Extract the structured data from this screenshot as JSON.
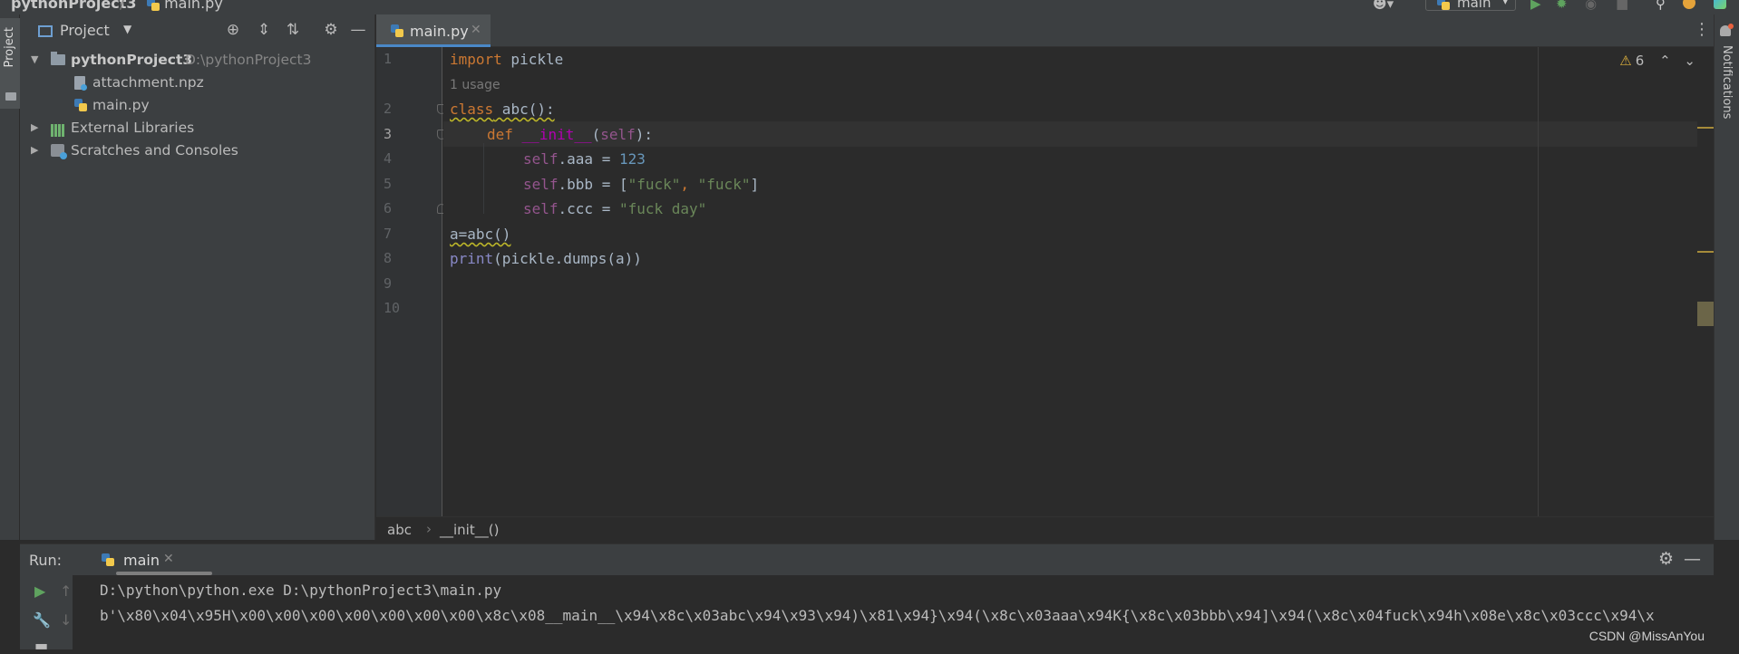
{
  "topbar": {
    "project_crumb": "pythonProject3",
    "separator": "/",
    "file_crumb": "main.py",
    "run_config": "main",
    "icons": [
      "add-user-icon",
      "run-icon",
      "debug-icon",
      "coverage-icon",
      "stop-icon",
      "search-icon",
      "update-icon",
      "jetbrains-logo-icon"
    ]
  },
  "left_strip": {
    "project_tab": "Project"
  },
  "project_panel": {
    "title": "Project",
    "header_icons": [
      "locate-icon",
      "expand-all-icon",
      "collapse-all-icon",
      "gear-icon",
      "minimize-icon"
    ],
    "tree": {
      "root_name": "pythonProject3",
      "root_path": "D:\\pythonProject3",
      "files": [
        "attachment.npz",
        "main.py"
      ],
      "external_libraries": "External Libraries",
      "scratches": "Scratches and Consoles"
    }
  },
  "editor": {
    "tab_label": "main.py",
    "line_numbers": [
      "1",
      "2",
      "3",
      "4",
      "5",
      "6",
      "7",
      "8",
      "9",
      "10"
    ],
    "usage_hint": "1 usage",
    "warnings_count": "6",
    "code": {
      "l1_kw": "import",
      "l1_rest": " pickle",
      "l2_kw": "class",
      "l2_rest": " abc():",
      "l3_kw": "def",
      "l3_fn": "__init__",
      "l3_open": "(",
      "l3_self": "self",
      "l3_close": "):",
      "l4_self": "self",
      "l4_attr": ".aaa = ",
      "l4_num": "123",
      "l5_self": "self",
      "l5_attr": ".bbb = [",
      "l5_s1": "\"fuck\"",
      "l5_comma": ", ",
      "l5_s2": "\"fuck\"",
      "l5_close": "]",
      "l6_self": "self",
      "l6_attr": ".ccc = ",
      "l6_str": "\"fuck day\"",
      "l7": "a=abc()",
      "l8_fn": "print",
      "l8_rest": "(pickle.dumps(a))"
    },
    "breadcrumb": {
      "class": "abc",
      "separator": "›",
      "method": "__init__()"
    }
  },
  "right_strip": {
    "notifications": "Notifications"
  },
  "run_panel": {
    "label": "Run:",
    "tab": "main",
    "console": [
      "D:\\python\\python.exe D:\\pythonProject3\\main.py",
      "b'\\x80\\x04\\x95H\\x00\\x00\\x00\\x00\\x00\\x00\\x00\\x8c\\x08__main__\\x94\\x8c\\x03abc\\x94\\x93\\x94)\\x81\\x94}\\x94(\\x8c\\x03aaa\\x94K{\\x8c\\x03bbb\\x94]\\x94(\\x8c\\x04fuck\\x94h\\x08e\\x8c\\x03ccc\\x94\\x"
    ]
  },
  "watermark": "CSDN @MissAnYou",
  "colors": {
    "keyword": "#cc7832",
    "self": "#94558d",
    "string": "#6a8759",
    "number": "#6897bb",
    "dunder": "#b200b2",
    "accent": "#4a88c7"
  }
}
